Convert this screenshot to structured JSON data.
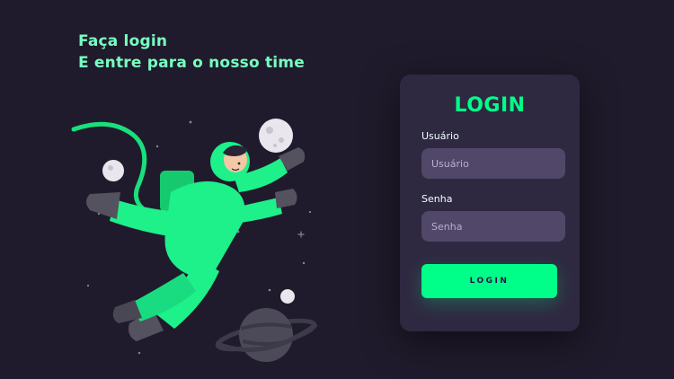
{
  "headline": {
    "line1": "Faça login",
    "line2": "E entre para o nosso time"
  },
  "illustration": {
    "icon": "astronaut-illustration-icon"
  },
  "login_card": {
    "title": "LOGIN",
    "username": {
      "label": "Usuário",
      "placeholder": "Usuário"
    },
    "password": {
      "label": "Senha",
      "placeholder": "Senha"
    },
    "submit_label": "LOGIN"
  },
  "colors": {
    "background": "#201b2c",
    "card": "#2f2841",
    "input": "#514869",
    "accent": "#00ff88",
    "headline": "#77ffc0"
  }
}
